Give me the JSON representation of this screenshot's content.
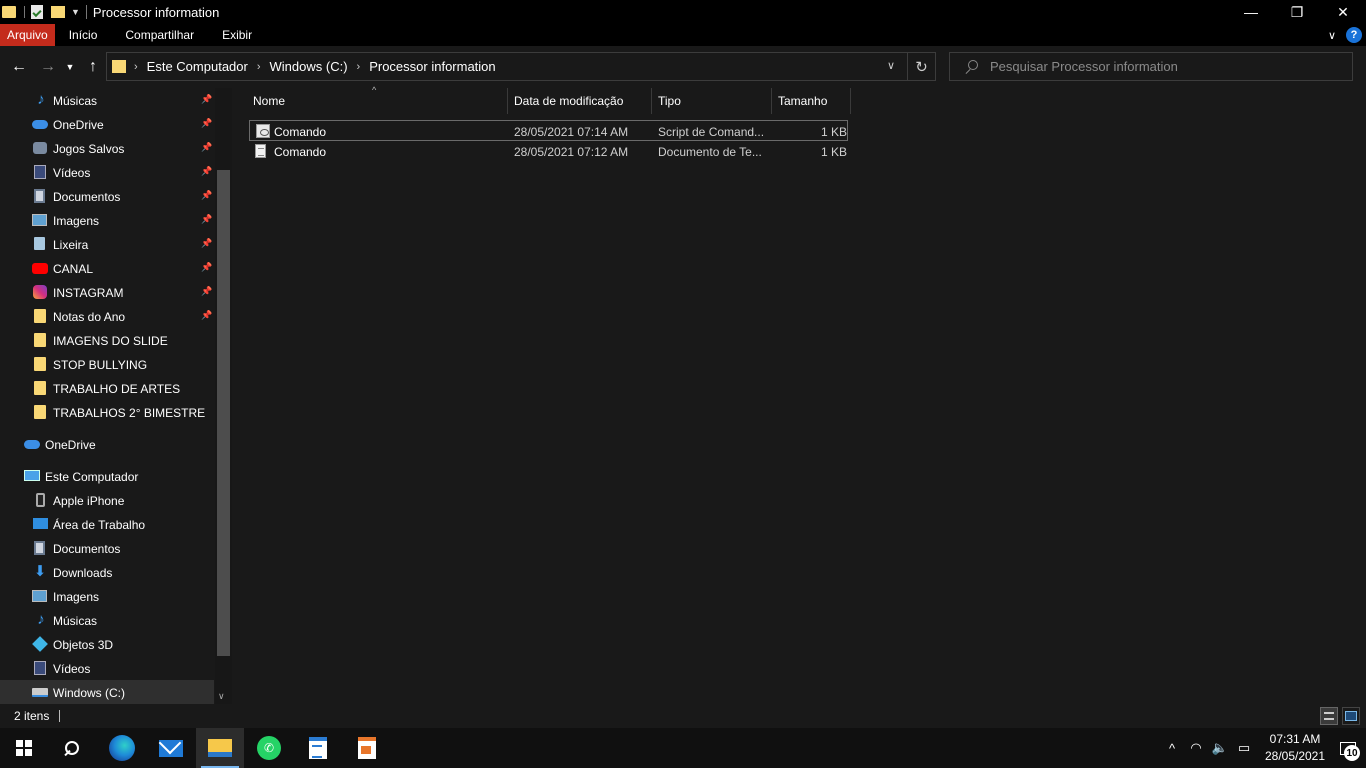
{
  "window": {
    "title": "Processor information",
    "controls": {
      "minimize": "—",
      "maximize": "❐",
      "close": "✕"
    }
  },
  "ribbon": {
    "tabs": [
      "Arquivo",
      "Início",
      "Compartilhar",
      "Exibir"
    ]
  },
  "navigation": {
    "back_icon": "back-arrow-icon",
    "forward_icon": "forward-arrow-icon",
    "up_icon": "up-arrow-icon",
    "breadcrumb": [
      "Este Computador",
      "Windows (C:)",
      "Processor information"
    ]
  },
  "search": {
    "placeholder": "Pesquisar Processor information"
  },
  "sidebar": {
    "quick_access": [
      {
        "label": "Músicas",
        "icon": "music-icon",
        "pinned": true
      },
      {
        "label": "OneDrive",
        "icon": "onedrive-icon",
        "pinned": true
      },
      {
        "label": "Jogos Salvos",
        "icon": "saved-games-icon",
        "pinned": true
      },
      {
        "label": "Vídeos",
        "icon": "videos-icon",
        "pinned": true
      },
      {
        "label": "Documentos",
        "icon": "documents-icon",
        "pinned": true
      },
      {
        "label": "Imagens",
        "icon": "pictures-icon",
        "pinned": true
      },
      {
        "label": "Lixeira",
        "icon": "recycle-bin-icon",
        "pinned": true
      },
      {
        "label": "CANAL",
        "icon": "youtube-icon",
        "pinned": true
      },
      {
        "label": "INSTAGRAM",
        "icon": "instagram-icon",
        "pinned": true
      },
      {
        "label": "Notas do Ano",
        "icon": "folder-icon",
        "pinned": true
      },
      {
        "label": "IMAGENS DO SLIDE",
        "icon": "folder-icon",
        "pinned": false
      },
      {
        "label": "STOP BULLYING",
        "icon": "folder-icon",
        "pinned": false
      },
      {
        "label": "TRABALHO DE ARTES",
        "icon": "folder-icon",
        "pinned": false
      },
      {
        "label": "TRABALHOS 2° BIMESTRE",
        "icon": "folder-icon",
        "pinned": false
      }
    ],
    "onedrive": {
      "label": "OneDrive",
      "icon": "onedrive-icon"
    },
    "this_pc": {
      "label": "Este Computador",
      "icon": "computer-icon"
    },
    "this_pc_items": [
      {
        "label": "Apple iPhone",
        "icon": "phone-icon"
      },
      {
        "label": "Área de Trabalho",
        "icon": "desktop-icon"
      },
      {
        "label": "Documentos",
        "icon": "documents-icon"
      },
      {
        "label": "Downloads",
        "icon": "downloads-icon"
      },
      {
        "label": "Imagens",
        "icon": "pictures-icon"
      },
      {
        "label": "Músicas",
        "icon": "music-icon"
      },
      {
        "label": "Objetos 3D",
        "icon": "3d-objects-icon"
      },
      {
        "label": "Vídeos",
        "icon": "videos-icon"
      },
      {
        "label": "Windows (C:)",
        "icon": "drive-icon",
        "selected": true
      }
    ]
  },
  "file_list": {
    "columns": [
      "Nome",
      "Data de modificação",
      "Tipo",
      "Tamanho"
    ],
    "rows": [
      {
        "name": "Comando",
        "modified": "28/05/2021 07:14 AM",
        "type": "Script de Comand...",
        "size": "1 KB",
        "icon": "batch-script-icon"
      },
      {
        "name": "Comando",
        "modified": "28/05/2021 07:12 AM",
        "type": "Documento de Te...",
        "size": "1 KB",
        "icon": "text-document-icon"
      }
    ]
  },
  "status": {
    "item_count": "2 itens"
  },
  "taskbar": {
    "apps": [
      "start-icon",
      "search-icon",
      "edge-icon",
      "mail-icon",
      "file-explorer-icon",
      "whatsapp-icon",
      "word-document-icon",
      "powerpoint-icon"
    ],
    "time": "07:31 AM",
    "date": "28/05/2021",
    "notification_count": "10"
  },
  "colors": {
    "accent_file_tab": "#c42b1c",
    "background": "#191919",
    "titlebar": "#000000",
    "folder": "#f8d775"
  }
}
